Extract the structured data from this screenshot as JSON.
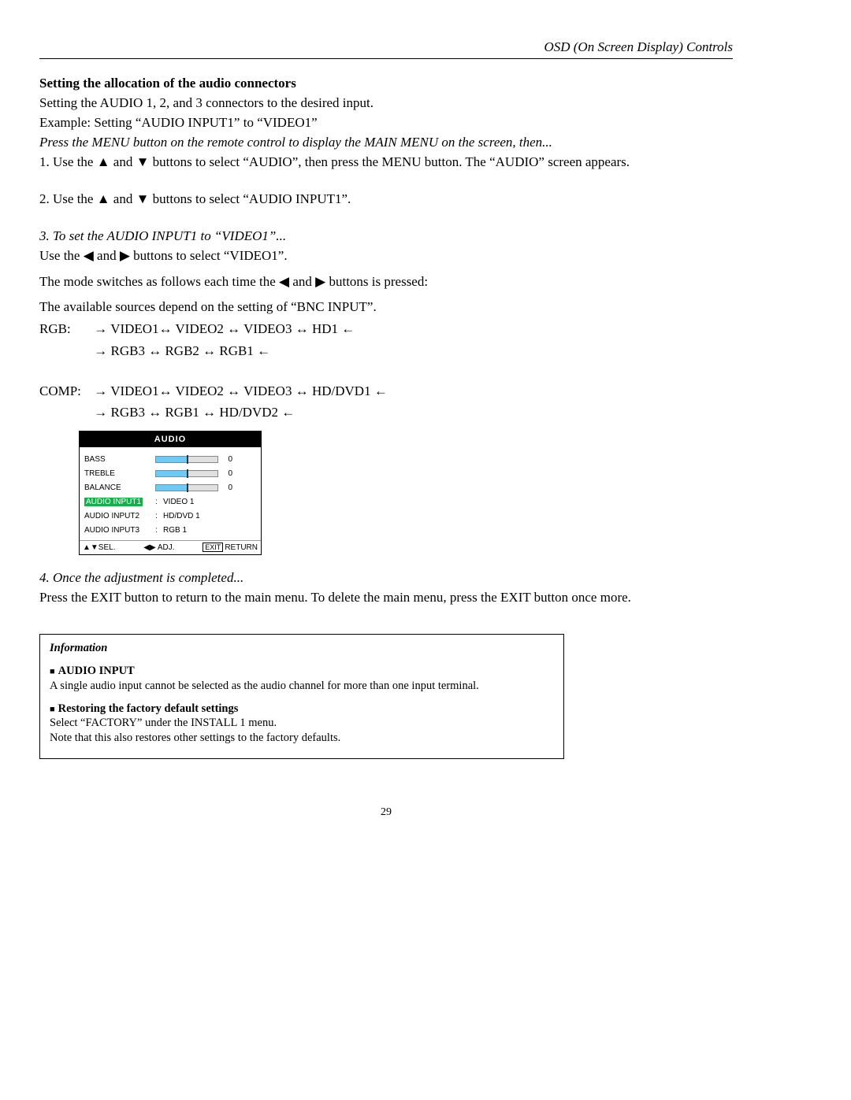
{
  "header": {
    "right": "OSD (On Screen Display) Controls"
  },
  "section": {
    "title": "Setting the allocation of the audio connectors",
    "line1": "Setting the AUDIO 1, 2, and 3 connectors to the desired input.",
    "line2": "Example: Setting “AUDIO INPUT1” to “VIDEO1”",
    "preamble": "Press the MENU button on the remote control to display the MAIN MENU on the screen, then...",
    "step1": "1. Use the ▲ and ▼ buttons to select “AUDIO”, then press the MENU button. The “AUDIO” screen appears.",
    "step2": "2. Use the ▲ and ▼ buttons to select “AUDIO INPUT1”.",
    "step3_head": "3. To set the AUDIO INPUT1 to “VIDEO1”...",
    "step3_a": "Use the ◀ and ▶ buttons to select “VIDEO1”.",
    "step3_b": "The mode switches as follows each time the  ◀ and ▶ buttons is pressed:",
    "step3_c": "The available sources depend on the setting of “BNC INPUT”.",
    "rgb_label": "RGB:",
    "rgb_line1": "→ VIDEO1↔ VIDEO2 ↔ VIDEO3 ↔ HD1 ←",
    "rgb_line2": "→ RGB3 ↔ RGB2 ↔ RGB1 ←",
    "comp_label": "COMP:",
    "comp_line1": "→ VIDEO1↔ VIDEO2 ↔ VIDEO3 ↔ HD/DVD1 ←",
    "comp_line2": "→ RGB3 ↔ RGB1 ↔ HD/DVD2 ←",
    "step4_head": "4. Once the adjustment is completed...",
    "step4_body": "Press the EXIT button to return to the main menu. To delete the main menu, press the EXIT button once more."
  },
  "osd": {
    "title": "AUDIO",
    "rows": [
      {
        "label": "BASS",
        "val": "0"
      },
      {
        "label": "TREBLE",
        "val": "0"
      },
      {
        "label": "BALANCE",
        "val": "0"
      }
    ],
    "inputs": [
      {
        "label": "AUDIO INPUT1",
        "val": "VIDEO 1",
        "selected": true
      },
      {
        "label": "AUDIO INPUT2",
        "val": "HD/DVD 1",
        "selected": false
      },
      {
        "label": "AUDIO INPUT3",
        "val": "RGB 1",
        "selected": false
      }
    ],
    "footer": {
      "sel": "SEL.",
      "adj": "ADJ.",
      "exit": "EXIT",
      "ret": "RETURN"
    }
  },
  "info": {
    "title": "Information",
    "h1": "AUDIO INPUT",
    "p1": "A single audio input cannot be selected as the audio channel for more than one input terminal.",
    "h2": "Restoring the factory default settings",
    "p2": "Select “FACTORY” under the INSTALL 1 menu.",
    "p3": "Note that this also restores other settings to the factory defaults."
  },
  "page": "29"
}
